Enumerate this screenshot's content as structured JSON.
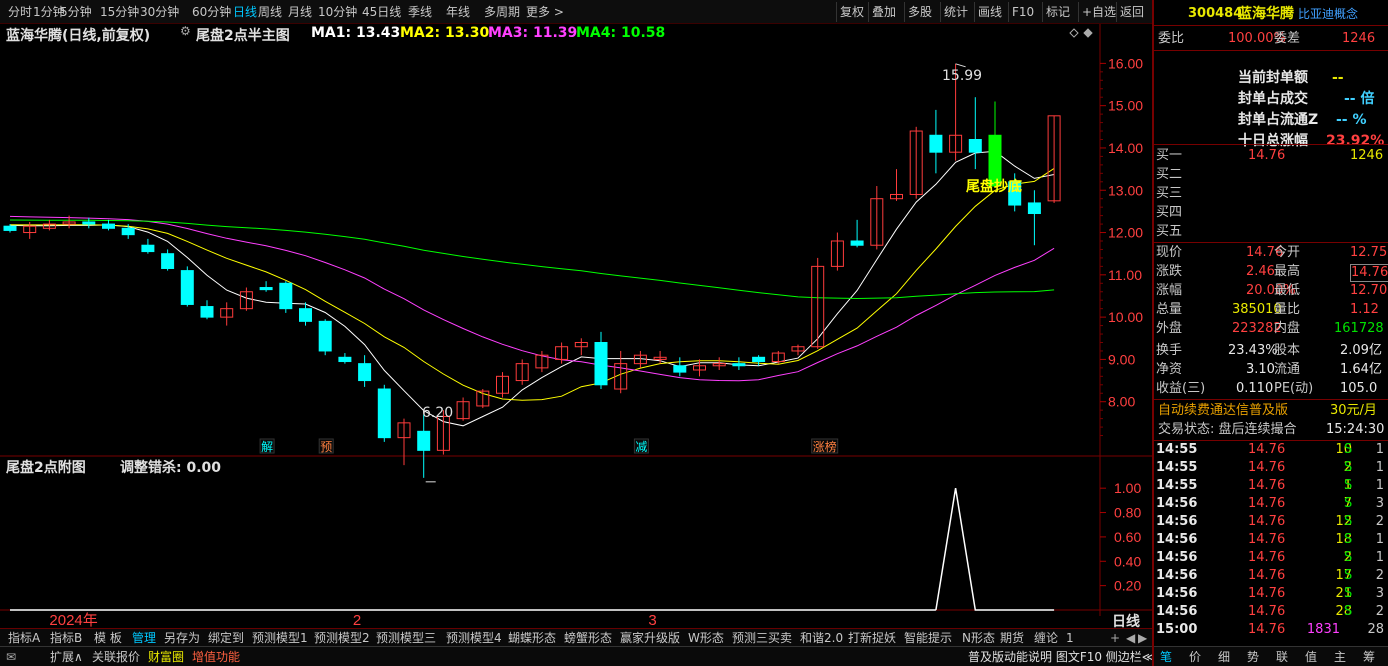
{
  "toolbar": {
    "periods": [
      "分时",
      "1分钟",
      "5分钟",
      "15分钟",
      "30分钟",
      "60分钟",
      "日线",
      "周线",
      "月线",
      "10分钟",
      "45日线",
      "季线",
      "年线",
      "多周期",
      "更多 >"
    ],
    "active_period": 6,
    "tools": [
      "复权",
      "叠加",
      "多股",
      "统计",
      "画线",
      "F10",
      "标记",
      "+自选",
      "返回"
    ]
  },
  "main": {
    "stock_title": "蓝海华腾(日线,前复权)",
    "indicator_icon": "gear-icon",
    "indicator_name": "尾盘2点半主图",
    "ma": [
      {
        "label": "MA1: 13.43",
        "color": "#ffffff"
      },
      {
        "label": "MA2: 13.30",
        "color": "#ffff00"
      },
      {
        "label": "MA3: 11.39",
        "color": "#ff40ff"
      },
      {
        "label": "MA4: 10.58",
        "color": "#00ff00"
      }
    ],
    "high_label": "15.99",
    "low_label": "6.20",
    "annotation": "尾盘抄底",
    "signals": [
      "解",
      "预",
      "减",
      "涨榜"
    ],
    "y_ticks": [
      "16.00",
      "15.00",
      "14.00",
      "13.00",
      "12.00",
      "11.00",
      "10.00",
      "9.00",
      "8.00"
    ]
  },
  "chart_data": {
    "type": "candlestick",
    "ylim": [
      7.0,
      16.6
    ],
    "ohlc": [
      [
        12.15,
        12.2,
        12.0,
        12.05
      ],
      [
        12.0,
        12.25,
        11.85,
        12.15
      ],
      [
        12.1,
        12.3,
        12.05,
        12.2
      ],
      [
        12.2,
        12.4,
        12.1,
        12.25
      ],
      [
        12.25,
        12.35,
        12.1,
        12.2
      ],
      [
        12.2,
        12.3,
        12.05,
        12.1
      ],
      [
        12.1,
        12.2,
        11.85,
        11.95
      ],
      [
        11.7,
        11.85,
        11.5,
        11.55
      ],
      [
        11.5,
        11.6,
        11.1,
        11.15
      ],
      [
        11.1,
        11.2,
        10.25,
        10.3
      ],
      [
        10.25,
        10.4,
        9.95,
        10.0
      ],
      [
        10.0,
        10.35,
        9.8,
        10.2
      ],
      [
        10.2,
        10.7,
        10.15,
        10.6
      ],
      [
        10.7,
        10.85,
        10.6,
        10.65
      ],
      [
        10.8,
        10.85,
        10.1,
        10.2
      ],
      [
        10.2,
        10.35,
        9.8,
        9.9
      ],
      [
        9.9,
        9.95,
        9.1,
        9.2
      ],
      [
        9.05,
        9.15,
        8.9,
        8.95
      ],
      [
        8.9,
        9.1,
        8.35,
        8.5
      ],
      [
        8.3,
        8.4,
        7.05,
        7.15
      ],
      [
        7.15,
        7.6,
        6.5,
        7.5
      ],
      [
        7.3,
        7.7,
        6.2,
        6.85
      ],
      [
        6.85,
        7.8,
        6.75,
        7.65
      ],
      [
        7.6,
        8.1,
        7.55,
        8.0
      ],
      [
        7.9,
        8.3,
        7.85,
        8.25
      ],
      [
        8.2,
        8.7,
        8.1,
        8.6
      ],
      [
        8.5,
        9.0,
        8.4,
        8.9
      ],
      [
        8.8,
        9.2,
        8.7,
        9.1
      ],
      [
        9.0,
        9.4,
        8.9,
        9.3
      ],
      [
        9.3,
        9.5,
        9.1,
        9.4
      ],
      [
        9.4,
        9.65,
        8.3,
        8.4
      ],
      [
        8.3,
        9.2,
        8.2,
        8.9
      ],
      [
        8.9,
        9.2,
        8.8,
        9.1
      ],
      [
        9.0,
        9.2,
        8.9,
        9.05
      ],
      [
        8.85,
        9.05,
        8.6,
        8.7
      ],
      [
        8.75,
        9.0,
        8.6,
        8.85
      ],
      [
        8.85,
        9.05,
        8.75,
        8.9
      ],
      [
        8.9,
        9.05,
        8.75,
        8.85
      ],
      [
        9.05,
        9.1,
        8.85,
        8.95
      ],
      [
        8.95,
        9.2,
        8.9,
        9.15
      ],
      [
        9.2,
        9.35,
        9.1,
        9.3
      ],
      [
        9.3,
        11.4,
        9.25,
        11.2
      ],
      [
        11.2,
        12.0,
        11.1,
        11.8
      ],
      [
        11.8,
        12.3,
        11.65,
        11.7
      ],
      [
        11.7,
        13.1,
        11.6,
        12.8
      ],
      [
        12.8,
        13.5,
        12.75,
        12.9
      ],
      [
        12.9,
        14.5,
        12.8,
        14.4
      ],
      [
        14.3,
        14.9,
        13.4,
        13.9
      ],
      [
        13.9,
        15.99,
        13.7,
        14.3
      ],
      [
        14.2,
        15.2,
        13.5,
        13.9
      ],
      [
        14.3,
        15.1,
        13.1,
        13.1
      ],
      [
        13.2,
        13.4,
        12.5,
        12.65
      ],
      [
        12.7,
        13.0,
        11.7,
        12.45
      ],
      [
        12.75,
        14.76,
        12.7,
        14.76
      ]
    ],
    "sub_indicator": {
      "name": "尾盘2点附图",
      "label": "调整错杀: 0.00",
      "ylim": [
        0,
        1.1
      ],
      "ticks": [
        "1.00",
        "0.80",
        "0.60",
        "0.40",
        "0.20"
      ],
      "spike_at": 48
    }
  },
  "xaxis": {
    "labels": [
      "2024年",
      "2",
      "3"
    ],
    "period": "日线"
  },
  "bottom_tabs": [
    "指标A",
    "指标B",
    "模 板",
    "管理",
    "另存为",
    "绑定到",
    "预测模型1",
    "预测模型2",
    "预测模型三",
    "预测模型4",
    "蝴蝶形态",
    "螃蟹形态",
    "赢家升级版",
    "W形态",
    "预测三买卖",
    "和谐2.0",
    "打新捉妖",
    "智能提示",
    "N形态",
    "期货",
    "缠论",
    "1"
  ],
  "bottom_tabs_active": 3,
  "status_left": [
    "扩展∧",
    "关联报价",
    "财富圈",
    "增值功能"
  ],
  "status_right": "普及版动能说明 图文F10 侧边栏≪",
  "right": {
    "code": "300484",
    "name": "蓝海华腾",
    "concept": "比亚迪概念",
    "weibi_label": "委比",
    "weibi_value": "100.00%",
    "weicha_label": "委差",
    "weicha_value": "1246",
    "seal": [
      {
        "label": "当前封单额",
        "value": "--"
      },
      {
        "label": "封单占成交",
        "value": "-- 倍"
      },
      {
        "label": "封单占流通Z",
        "value": "-- %"
      },
      {
        "label": "十日总涨幅",
        "value": "23.92%"
      }
    ],
    "book": [
      {
        "label": "买一",
        "price": "14.76",
        "vol": "1246"
      },
      {
        "label": "买二",
        "price": "",
        "vol": ""
      },
      {
        "label": "买三",
        "price": "",
        "vol": ""
      },
      {
        "label": "买四",
        "price": "",
        "vol": ""
      },
      {
        "label": "买五",
        "price": "",
        "vol": ""
      }
    ],
    "quote": [
      {
        "l1": "现价",
        "v1": "14.76",
        "l2": "今开",
        "v2": "12.75"
      },
      {
        "l1": "涨跌",
        "v1": "2.46",
        "l2": "最高",
        "v2": "14.76"
      },
      {
        "l1": "涨幅",
        "v1": "20.00%",
        "l2": "最低",
        "v2": "12.70"
      },
      {
        "l1": "总量",
        "v1": "385010",
        "l2": "量比",
        "v2": "1.12"
      },
      {
        "l1": "外盘",
        "v1": "223282",
        "l2": "内盘",
        "v2": "161728"
      },
      {
        "l1": "换手",
        "v1": "23.43%",
        "l2": "股本",
        "v2": "2.09亿"
      },
      {
        "l1": "净资",
        "v1": "3.10",
        "l2": "流通",
        "v2": "1.64亿"
      },
      {
        "l1": "收益(三)",
        "v1": "0.110",
        "l2": "PE(动)",
        "v2": "105.0"
      }
    ],
    "promo": "自动续费通达信普及版",
    "promo_price": "30元/月",
    "trade_status": "交易状态: 盘后连续撮合",
    "trade_time": "15:24:30",
    "ticks": [
      {
        "t": "14:55",
        "p": "14.76",
        "v": "10",
        "s": "S",
        "n": "1"
      },
      {
        "t": "14:55",
        "p": "14.76",
        "v": "2",
        "s": "S",
        "n": "1"
      },
      {
        "t": "14:55",
        "p": "14.76",
        "v": "1",
        "s": "S",
        "n": "1"
      },
      {
        "t": "14:56",
        "p": "14.76",
        "v": "7",
        "s": "S",
        "n": "3"
      },
      {
        "t": "14:56",
        "p": "14.76",
        "v": "12",
        "s": "S",
        "n": "2"
      },
      {
        "t": "14:56",
        "p": "14.76",
        "v": "18",
        "s": "S",
        "n": "1"
      },
      {
        "t": "14:56",
        "p": "14.76",
        "v": "2",
        "s": "S",
        "n": "1"
      },
      {
        "t": "14:56",
        "p": "14.76",
        "v": "17",
        "s": "S",
        "n": "2"
      },
      {
        "t": "14:56",
        "p": "14.76",
        "v": "21",
        "s": "S",
        "n": "3"
      },
      {
        "t": "14:56",
        "p": "14.76",
        "v": "28",
        "s": "S",
        "n": "2"
      },
      {
        "t": "15:00",
        "p": "14.76",
        "v": "1831",
        "s": "",
        "n": "28"
      }
    ],
    "bottom_tabs": [
      "笔",
      "价",
      "细",
      "势",
      "联",
      "值",
      "主",
      "筹"
    ]
  }
}
